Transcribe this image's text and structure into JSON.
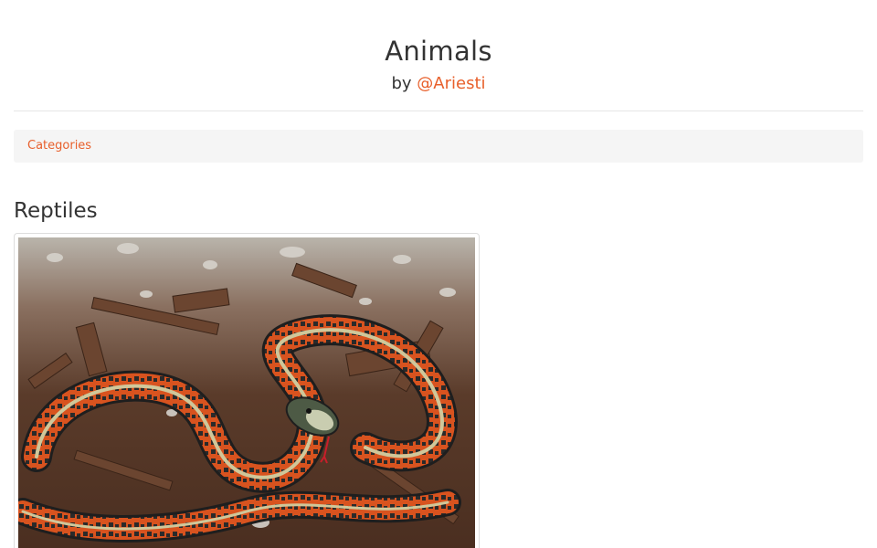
{
  "header": {
    "title": "Animals",
    "byline_prefix": "by",
    "author": "@Ariesti"
  },
  "nav": {
    "categories_label": "Categories"
  },
  "section": {
    "heading": "Reptiles",
    "image_subject": "red-sided garter snake coiled on bark mulch"
  },
  "colors": {
    "accent": "#e8602c",
    "text": "#333333",
    "nav_bg": "#f5f5f5",
    "divider": "#e6e6e6"
  }
}
